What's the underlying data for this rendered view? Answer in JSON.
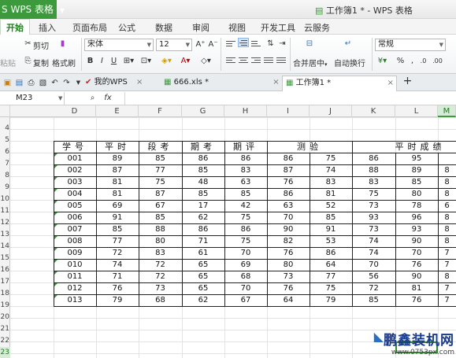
{
  "app": {
    "name": "WPS 表格",
    "logo": "S",
    "window_title": "工作簿1 * - WPS 表格"
  },
  "ribbon_tabs": [
    "开始",
    "插入",
    "页面布局",
    "公式",
    "数据",
    "审阅",
    "视图",
    "开发工具",
    "云服务"
  ],
  "clipboard": {
    "paste": "粘贴",
    "cut": "剪切",
    "copy": "复制",
    "format_painter": "格式刷"
  },
  "font": {
    "name": "宋体",
    "size": "12",
    "bold": "B",
    "italic": "I",
    "underline": "U"
  },
  "merge_label": "合并居中",
  "wrap_label": "自动换行",
  "number_format": "常规",
  "doc_tabs": [
    "我的WPS",
    "666.xls *",
    "工作簿1 *"
  ],
  "name_box": "M23",
  "fx_label": "fx",
  "columns": [
    "D",
    "E",
    "F",
    "G",
    "H",
    "I",
    "J",
    "K",
    "L",
    "M"
  ],
  "selected_column": "M",
  "rows": [
    "4",
    "5",
    "6",
    "7",
    "8",
    "9",
    "10",
    "11",
    "12",
    "13",
    "14",
    "15",
    "16",
    "17",
    "18",
    "19",
    "20",
    "21",
    "22",
    "23",
    "24"
  ],
  "selected_row": "23",
  "table": {
    "headers": [
      "学号",
      "平时",
      "段考",
      "期考",
      "期评",
      "测验",
      "平时成绩"
    ],
    "data": [
      [
        "001",
        "89",
        "85",
        "86",
        "86",
        "86",
        "75",
        "86",
        "95",
        ""
      ],
      [
        "002",
        "87",
        "77",
        "85",
        "83",
        "87",
        "74",
        "88",
        "89",
        "8"
      ],
      [
        "003",
        "81",
        "75",
        "48",
        "63",
        "76",
        "83",
        "83",
        "85",
        "8"
      ],
      [
        "004",
        "81",
        "87",
        "85",
        "85",
        "86",
        "81",
        "75",
        "80",
        "8"
      ],
      [
        "005",
        "69",
        "67",
        "17",
        "42",
        "63",
        "52",
        "73",
        "78",
        "6"
      ],
      [
        "006",
        "91",
        "85",
        "62",
        "75",
        "70",
        "85",
        "93",
        "96",
        "8"
      ],
      [
        "007",
        "85",
        "88",
        "86",
        "86",
        "90",
        "91",
        "73",
        "93",
        "8"
      ],
      [
        "008",
        "77",
        "80",
        "71",
        "75",
        "82",
        "53",
        "74",
        "90",
        "8"
      ],
      [
        "009",
        "72",
        "83",
        "61",
        "70",
        "76",
        "86",
        "74",
        "70",
        "7"
      ],
      [
        "010",
        "74",
        "72",
        "65",
        "69",
        "80",
        "64",
        "70",
        "76",
        "7"
      ],
      [
        "011",
        "71",
        "72",
        "65",
        "68",
        "73",
        "77",
        "56",
        "90",
        "8"
      ],
      [
        "012",
        "76",
        "73",
        "65",
        "70",
        "76",
        "75",
        "72",
        "81",
        "7"
      ],
      [
        "013",
        "79",
        "68",
        "62",
        "67",
        "64",
        "79",
        "85",
        "76",
        "7"
      ]
    ]
  },
  "watermark": {
    "line1": "鹏鑫装机网",
    "line2": "www.0753px.com"
  }
}
